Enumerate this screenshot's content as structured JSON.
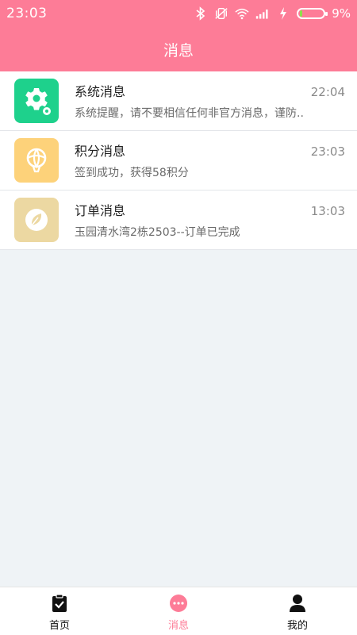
{
  "status_bar": {
    "time": "23:03",
    "battery_percent": "9%",
    "icons": [
      "bluetooth-icon",
      "vibrate-off-icon",
      "wifi-icon",
      "signal-icon",
      "charging-icon",
      "battery-icon"
    ]
  },
  "header": {
    "title": "消息"
  },
  "messages": [
    {
      "title": "系统消息",
      "time": "22:04",
      "preview": "系统提醒，请不要相信任何非官方消息，谨防..",
      "icon": "gear-icon",
      "color": "#1ed18c"
    },
    {
      "title": "积分消息",
      "time": "23:03",
      "preview": "签到成功，获得58积分",
      "icon": "balloon-icon",
      "color": "#fdd27a"
    },
    {
      "title": "订单消息",
      "time": "13:03",
      "preview": "玉园清水湾2栋2503--订单已完成",
      "icon": "leaf-icon",
      "color": "#ecd8a2"
    }
  ],
  "tabbar": {
    "tabs": [
      {
        "label": "首页",
        "icon": "clipboard-check-icon",
        "active": false
      },
      {
        "label": "消息",
        "icon": "chat-bubble-icon",
        "active": true
      },
      {
        "label": "我的",
        "icon": "user-icon",
        "active": false
      }
    ],
    "active_color": "#fd7c97"
  }
}
